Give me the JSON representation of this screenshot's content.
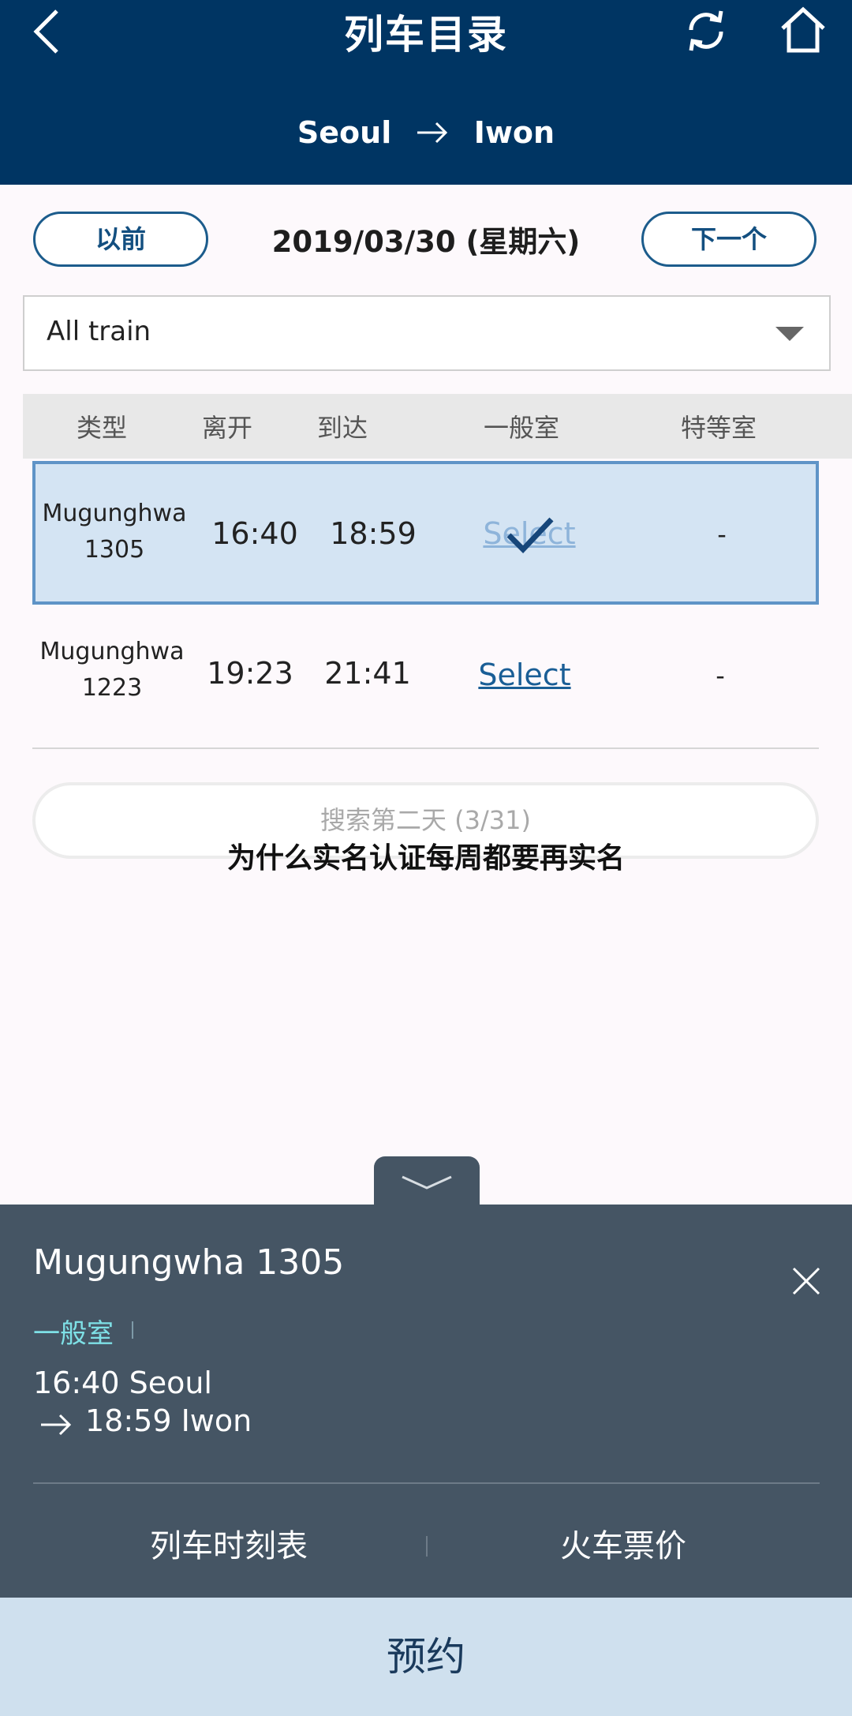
{
  "header": {
    "title": "列车目录",
    "route": {
      "from": "Seoul",
      "to": "Iwon"
    }
  },
  "date_nav": {
    "prev_label": "以前",
    "date": "2019/03/30 (星期六)",
    "next_label": "下一个"
  },
  "filter": {
    "selected": "All train"
  },
  "table": {
    "headers": [
      "类型",
      "离开",
      "到达",
      "一般室",
      "特等室"
    ],
    "rows": [
      {
        "name_line1": "Mugunghwa",
        "name_line2": "1305",
        "depart": "16:40",
        "arrive": "18:59",
        "general": "Select",
        "special": "-",
        "selected": true
      },
      {
        "name_line1": "Mugunghwa",
        "name_line2": "1223",
        "depart": "19:23",
        "arrive": "21:41",
        "general": "Select",
        "special": "-",
        "selected": false
      }
    ]
  },
  "next_day_button": "搜索第二天 (3/31)",
  "overlay_text": "为什么实名认证每周都要再实名",
  "panel": {
    "train": "Mugungwha 1305",
    "class": "一般室",
    "depart": "16:40 Seoul",
    "arrive": "18:59 Iwon",
    "timetable_label": "列车时刻表",
    "fare_label": "火车票价"
  },
  "reserve_label": "预约",
  "colors": {
    "header_bg": "#003563",
    "panel_bg": "#455564",
    "accent_link": "#1a5e96",
    "class_text": "#7ee0e6",
    "selected_row_bg": "#d4e4f3",
    "reserve_bg": "#cfe0ee"
  },
  "icons": [
    "back-icon",
    "refresh-icon",
    "home-icon",
    "arrow-right-icon",
    "caret-down-icon",
    "check-icon",
    "chevron-down-icon",
    "close-icon"
  ]
}
